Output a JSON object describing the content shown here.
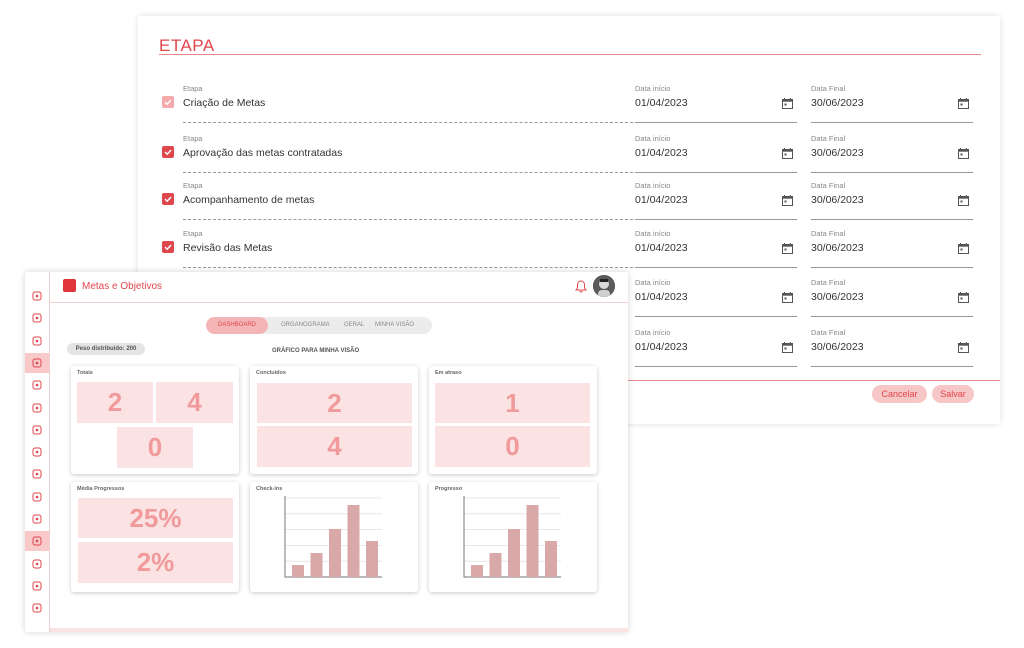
{
  "etapa_panel": {
    "title": "ETAPA",
    "step_label": "Etapa",
    "start_label": "Data início",
    "end_label": "Data Final",
    "rows": [
      {
        "name": "Criação de Metas",
        "start": "01/04/2023",
        "end": "30/06/2023",
        "checked": true
      },
      {
        "name": "Aprovação das metas contratadas",
        "start": "01/04/2023",
        "end": "30/06/2023",
        "checked": true
      },
      {
        "name": "Acompanhamento de metas",
        "start": "01/04/2023",
        "end": "30/06/2023",
        "checked": true
      },
      {
        "name": "Revisão das Metas",
        "start": "01/04/2023",
        "end": "30/06/2023",
        "checked": true
      },
      {
        "name": "",
        "start": "01/04/2023",
        "end": "30/06/2023",
        "checked": false
      },
      {
        "name": "",
        "start": "01/04/2023",
        "end": "30/06/2023",
        "checked": false
      }
    ],
    "cancel_label": "Cancelar",
    "save_label": "Salvar"
  },
  "app": {
    "title": "Metas e Objetivos",
    "brand_color": "#e0363c",
    "tabs": [
      "DASHBOARD",
      "ORGANOGRAMA",
      "GERAL",
      "MINHA VISÃO"
    ],
    "active_tab": "DASHBOARD",
    "peso": "Peso distribuído: 200",
    "chart_heading": "GRÁFICO PARA MINHA VISÃO",
    "sidebar_icons": [
      "home-icon",
      "flag-icon",
      "sitemap-icon",
      "org-chart-icon",
      "hierarchy-icon",
      "person-chart-icon",
      "smiley-icon",
      "document-icon",
      "globe-icon",
      "plus-circle-icon",
      "people-icon",
      "warning-icon",
      "lightbulb-icon",
      "book-icon",
      "group-icon"
    ],
    "sidebar_active": [
      3,
      11
    ]
  },
  "cards": {
    "totais": {
      "title": "Totais",
      "values": [
        "2",
        "4",
        "0"
      ]
    },
    "concluidos": {
      "title": "Concluídos",
      "values": [
        "2",
        "4"
      ]
    },
    "em_atraso": {
      "title": "Em atraso",
      "values": [
        "1",
        "0"
      ]
    },
    "media": {
      "title": "Média Progressos",
      "values": [
        "25%",
        "2%"
      ]
    },
    "checkins": {
      "title": "Check-ins"
    },
    "progresso": {
      "title": "Progresso"
    }
  },
  "chart_data": [
    {
      "type": "bar",
      "title": "Check-ins",
      "values": [
        2,
        4,
        8,
        12,
        6
      ],
      "color": "#d9a9aa"
    },
    {
      "type": "bar",
      "title": "Progresso",
      "values": [
        2,
        4,
        8,
        12,
        6
      ],
      "color": "#d9a9aa"
    }
  ]
}
